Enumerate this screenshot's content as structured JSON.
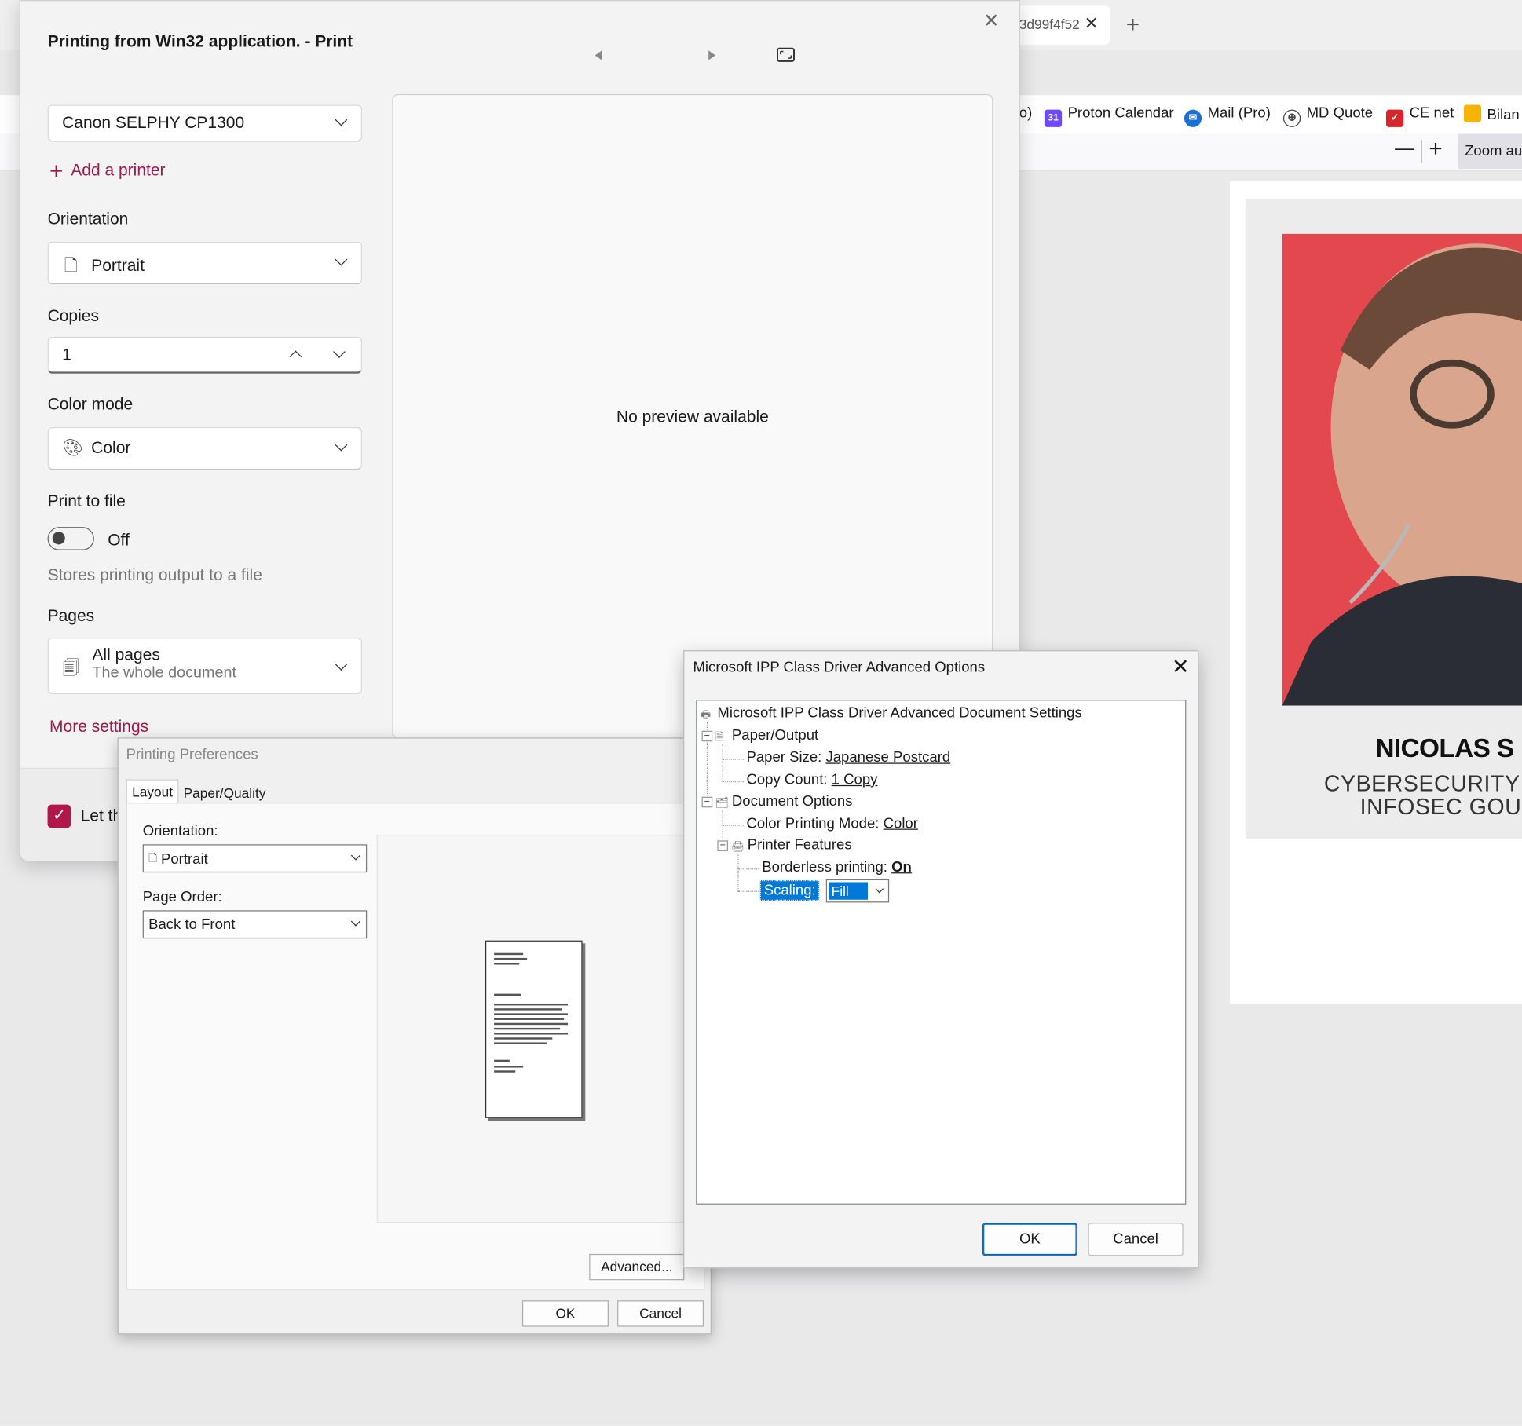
{
  "browser": {
    "tab_title": "3d99f4f52",
    "new_tab": "+",
    "bookmarks": [
      {
        "label": "o)",
        "icon": ""
      },
      {
        "label": "Proton Calendar",
        "icon": "31"
      },
      {
        "label": "Mail (Pro)",
        "icon": "mail-icon"
      },
      {
        "label": "MD Quote",
        "icon": "globe-icon"
      },
      {
        "label": "CE net",
        "icon": "ce-icon"
      },
      {
        "label": "Bilan",
        "icon": "folder-icon"
      }
    ],
    "zoom_minus": "—",
    "zoom_plus": "+",
    "zoom_label": "Zoom au"
  },
  "document": {
    "name": "NICOLAS S",
    "subtitle_line1": "CYBERSECURITY",
    "subtitle_line2": "INFOSEC GOU"
  },
  "print_dialog": {
    "title": "Printing from Win32 application. - Print",
    "printer": "Canon SELPHY CP1300",
    "add_printer": "Add a printer",
    "orientation_label": "Orientation",
    "orientation_value": "Portrait",
    "copies_label": "Copies",
    "copies_value": "1",
    "color_mode_label": "Color mode",
    "color_mode_value": "Color",
    "print_to_file_label": "Print to file",
    "print_to_file_state": "Off",
    "print_to_file_desc": "Stores printing output to a file",
    "pages_label": "Pages",
    "pages_value": "All pages",
    "pages_sub": "The whole document",
    "more_settings": "More settings",
    "let_text": "Let th",
    "preview_text": "No preview available"
  },
  "printing_preferences": {
    "title": "Printing Preferences",
    "tabs": [
      "Layout",
      "Paper/Quality"
    ],
    "orientation_label": "Orientation:",
    "orientation_value": "Portrait",
    "page_order_label": "Page Order:",
    "page_order_value": "Back to Front",
    "advanced_button": "Advanced...",
    "ok_button": "OK",
    "cancel_button": "Cancel"
  },
  "advanced_options": {
    "title": "Microsoft IPP Class Driver Advanced Options",
    "root": "Microsoft IPP Class Driver Advanced Document Settings",
    "paper_output": "Paper/Output",
    "paper_size_label": "Paper Size:",
    "paper_size_value": "Japanese Postcard",
    "copy_count_label": "Copy Count:",
    "copy_count_value": "1 Copy",
    "document_options": "Document Options",
    "color_mode_label": "Color Printing Mode:",
    "color_mode_value": "Color",
    "printer_features": "Printer Features",
    "borderless_label": "Borderless printing:",
    "borderless_value": "On",
    "scaling_label": "Scaling:",
    "scaling_value": "Fill",
    "ok_button": "OK",
    "cancel_button": "Cancel"
  },
  "colors": {
    "accent": "#9c1a4b",
    "selection": "#0078d7",
    "photo_bg": "#e3484e"
  }
}
